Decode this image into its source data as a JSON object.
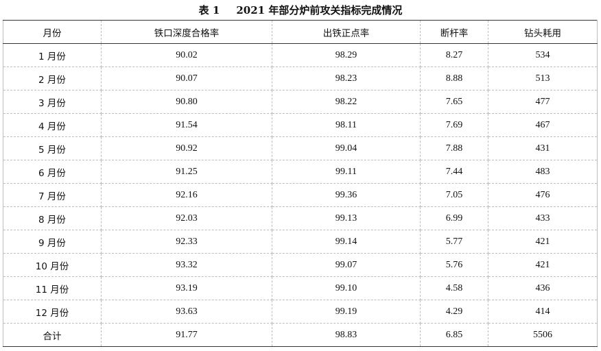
{
  "caption": {
    "label": "表 1",
    "title": "2021 年部分炉前攻关指标完成情况"
  },
  "table": {
    "headers": [
      "月份",
      "铁口深度合格率",
      "出铁正点率",
      "断杆率",
      "钻头耗用"
    ],
    "rows": [
      [
        "1 月份",
        "90.02",
        "98.29",
        "8.27",
        "534"
      ],
      [
        "2 月份",
        "90.07",
        "98.23",
        "8.88",
        "513"
      ],
      [
        "3 月份",
        "90.80",
        "98.22",
        "7.65",
        "477"
      ],
      [
        "4 月份",
        "91.54",
        "98.11",
        "7.69",
        "467"
      ],
      [
        "5 月份",
        "90.92",
        "99.04",
        "7.88",
        "431"
      ],
      [
        "6 月份",
        "91.25",
        "99.11",
        "7.44",
        "483"
      ],
      [
        "7 月份",
        "92.16",
        "99.36",
        "7.05",
        "476"
      ],
      [
        "8 月份",
        "92.03",
        "99.13",
        "6.99",
        "433"
      ],
      [
        "9 月份",
        "92.33",
        "99.14",
        "5.77",
        "421"
      ],
      [
        "10 月份",
        "93.32",
        "99.07",
        "5.76",
        "421"
      ],
      [
        "11 月份",
        "93.19",
        "99.10",
        "4.58",
        "436"
      ],
      [
        "12 月份",
        "93.63",
        "99.19",
        "4.29",
        "414"
      ],
      [
        "合计",
        "91.77",
        "98.83",
        "6.85",
        "5506"
      ]
    ]
  }
}
